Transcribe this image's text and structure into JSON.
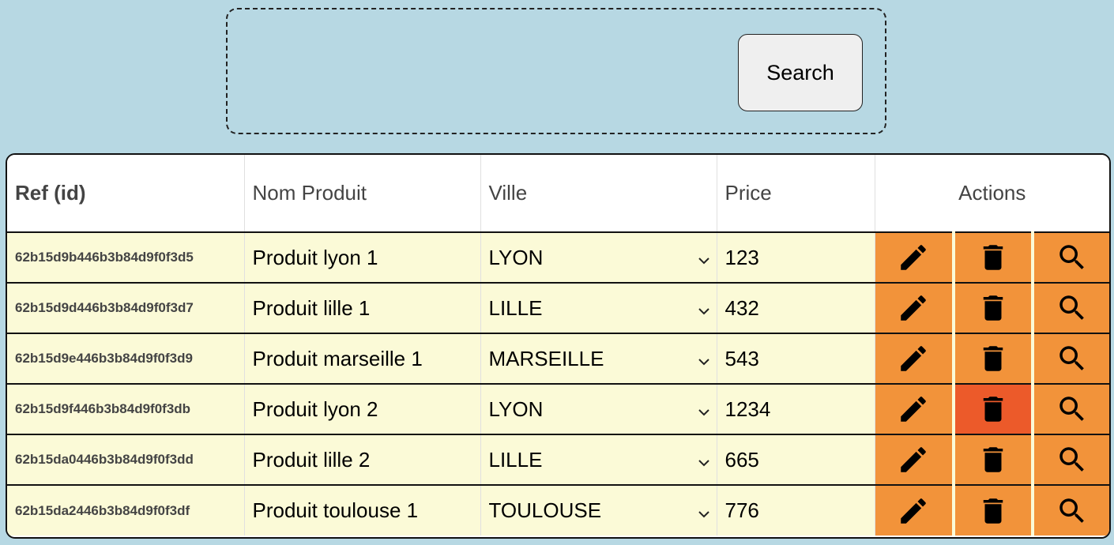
{
  "search": {
    "button_label": "Search"
  },
  "table": {
    "headers": {
      "ref": "Ref (id)",
      "name": "Nom Produit",
      "city": "Ville",
      "price": "Price",
      "actions": "Actions"
    },
    "rows": [
      {
        "ref": "62b15d9b446b3b84d9f0f3d5",
        "name": "Produit lyon 1",
        "city": "LYON",
        "price": "123"
      },
      {
        "ref": "62b15d9d446b3b84d9f0f3d7",
        "name": "Produit lille 1",
        "city": "LILLE",
        "price": "432"
      },
      {
        "ref": "62b15d9e446b3b84d9f0f3d9",
        "name": "Produit marseille 1",
        "city": "MARSEILLE",
        "price": "543"
      },
      {
        "ref": "62b15d9f446b3b84d9f0f3db",
        "name": "Produit lyon 2",
        "city": "LYON",
        "price": "1234"
      },
      {
        "ref": "62b15da0446b3b84d9f0f3dd",
        "name": "Produit lille 2",
        "city": "LILLE",
        "price": "665"
      },
      {
        "ref": "62b15da2446b3b84d9f0f3df",
        "name": "Produit toulouse 1",
        "city": "TOULOUSE",
        "price": "776"
      }
    ],
    "action_icons": [
      "edit-icon",
      "delete-icon",
      "search-icon"
    ],
    "hovered_delete_row": 3
  },
  "colors": {
    "page_background": "#b7d8e3",
    "row_background": "#fbfad7",
    "action_background": "#f2933a",
    "action_hover": "#ec5a2a"
  }
}
